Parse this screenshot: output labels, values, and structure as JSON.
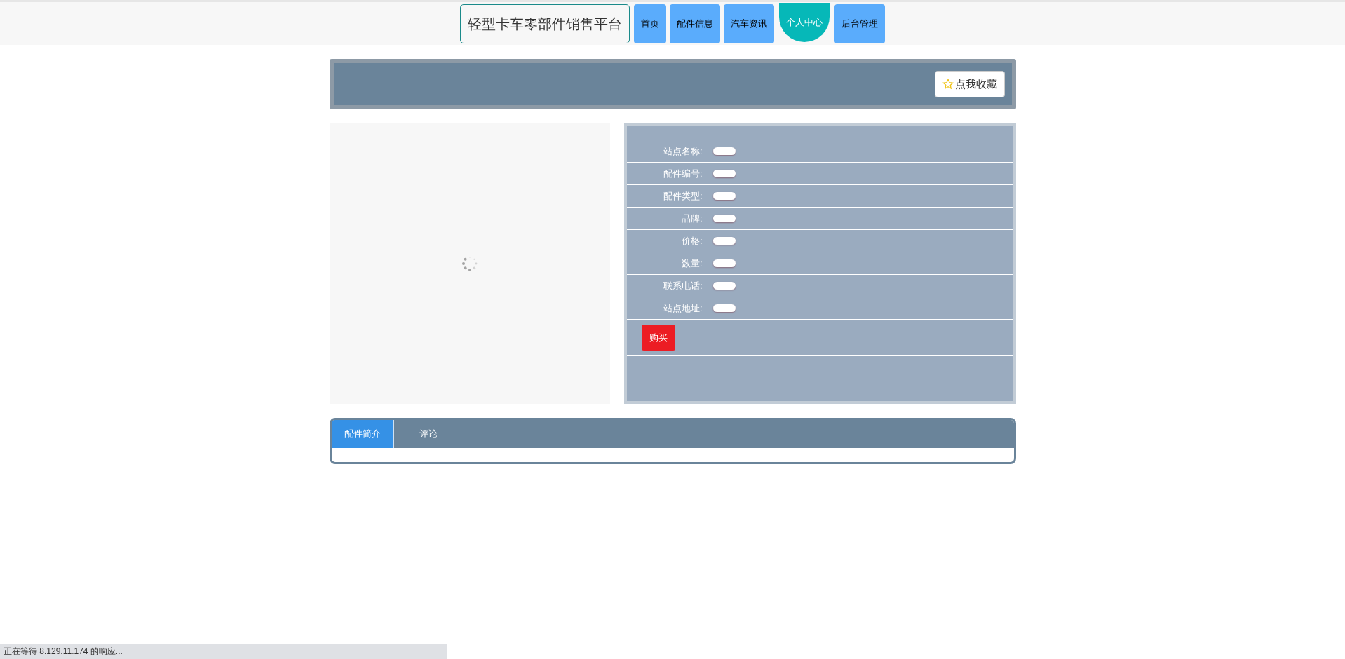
{
  "header": {
    "site_title": "轻型卡车零部件销售平台",
    "nav": [
      {
        "label": "首页",
        "selected": false
      },
      {
        "label": "配件信息",
        "selected": false
      },
      {
        "label": "汽车资讯",
        "selected": false
      },
      {
        "label": "个人中心",
        "selected": true
      },
      {
        "label": "后台管理",
        "selected": false
      }
    ]
  },
  "banner": {
    "favorite_button": "点我收藏"
  },
  "product": {
    "image": {
      "kind": "loading"
    },
    "fields": [
      {
        "label": "站点名称:"
      },
      {
        "label": "配件编号:"
      },
      {
        "label": "配件类型:"
      },
      {
        "label": "品牌:"
      },
      {
        "label": "价格:"
      },
      {
        "label": "数量:"
      },
      {
        "label": "联系电话:"
      },
      {
        "label": "站点地址:"
      }
    ],
    "buy_button": "购买"
  },
  "tabs": [
    {
      "label": "配件简介",
      "selected": true
    },
    {
      "label": "评论",
      "selected": false
    }
  ],
  "status_bar": "正在等待 8.129.11.174 的响应..."
}
